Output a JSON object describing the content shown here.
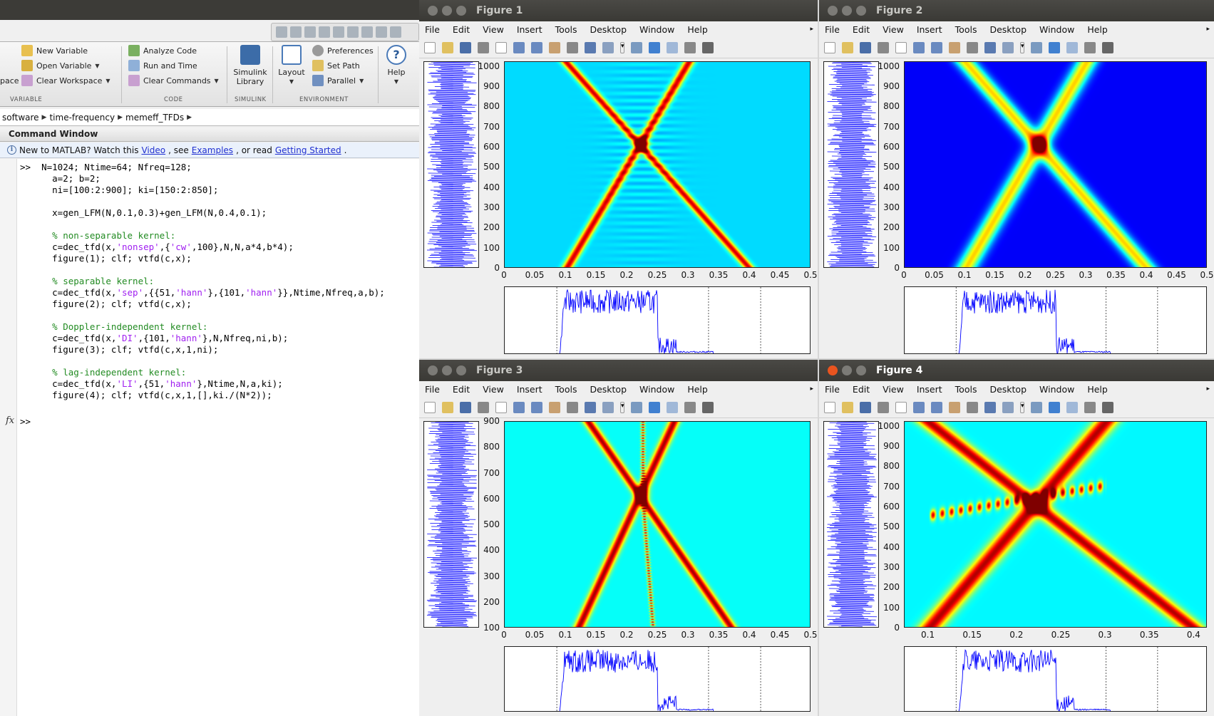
{
  "matlab": {
    "ribbon": {
      "variable": {
        "new_variable": "New Variable",
        "open_variable": "Open Variable",
        "clear_workspace": "Clear Workspace",
        "group": "VARIABLE",
        "partial": "pace"
      },
      "code": {
        "analyze_code": "Analyze Code",
        "run_and_time": "Run and Time",
        "clear_commands": "Clear Commands",
        "group": "CODE"
      },
      "simulink": {
        "label_1": "Simulink",
        "label_2": "Library",
        "group": "SIMULINK"
      },
      "environment": {
        "layout": "Layout",
        "preferences": "Preferences",
        "set_path": "Set Path",
        "parallel": "Parallel",
        "group": "ENVIRONMENT"
      },
      "help": "Help"
    },
    "path": [
      "software",
      "time-frequency",
      "memeff_TFDs"
    ],
    "command_window_title": "Command Window",
    "news": {
      "text_1": "New to MATLAB? Watch this ",
      "video": "Video",
      "text_2": ", see ",
      "examples": "Examples",
      "text_3": ", or read ",
      "getting_started": "Getting Started",
      "text_4": "."
    },
    "prompt": ">>",
    "fx": "fx",
    "code": [
      [
        {
          "t": ">>  N=1024; Ntime=64; Nfreq=128;",
          "c": ""
        }
      ],
      [
        {
          "t": "      a=2; b=2;",
          "c": ""
        }
      ],
      [
        {
          "t": "      ni=[100:2:900]; ki=[150:2:850];",
          "c": ""
        }
      ],
      [
        {
          "t": "",
          "c": ""
        }
      ],
      [
        {
          "t": "      x=gen_LFM(N,0.1,0.3)+gen_LFM(N,0.4,0.1);",
          "c": ""
        }
      ],
      [
        {
          "t": "",
          "c": ""
        }
      ],
      [
        {
          "t": "      % non-separable kernel:",
          "c": "cm"
        }
      ],
      [
        {
          "t": "      c=dec_tfd(x,",
          "c": ""
        },
        {
          "t": "'nonsep'",
          "c": "st"
        },
        {
          "t": ",{",
          "c": ""
        },
        {
          "t": "'cw'",
          "c": "st"
        },
        {
          "t": ",100},N,N,a*4,b*4);",
          "c": ""
        }
      ],
      [
        {
          "t": "      figure(1); clf; vtfd(c,x);",
          "c": ""
        }
      ],
      [
        {
          "t": "",
          "c": ""
        }
      ],
      [
        {
          "t": "      % separable kernel:",
          "c": "cm"
        }
      ],
      [
        {
          "t": "      c=dec_tfd(x,",
          "c": ""
        },
        {
          "t": "'sep'",
          "c": "st"
        },
        {
          "t": ",{{51,",
          "c": ""
        },
        {
          "t": "'hann'",
          "c": "st"
        },
        {
          "t": "},{101,",
          "c": ""
        },
        {
          "t": "'hann'",
          "c": "st"
        },
        {
          "t": "}},Ntime,Nfreq,a,b);",
          "c": ""
        }
      ],
      [
        {
          "t": "      figure(2); clf; vtfd(c,x);",
          "c": ""
        }
      ],
      [
        {
          "t": "",
          "c": ""
        }
      ],
      [
        {
          "t": "      % Doppler-independent kernel:",
          "c": "cm"
        }
      ],
      [
        {
          "t": "      c=dec_tfd(x,",
          "c": ""
        },
        {
          "t": "'DI'",
          "c": "st"
        },
        {
          "t": ",{101,",
          "c": ""
        },
        {
          "t": "'hann'",
          "c": "st"
        },
        {
          "t": "},N,Nfreq,ni,b);",
          "c": ""
        }
      ],
      [
        {
          "t": "      figure(3); clf; vtfd(c,x,1,ni);",
          "c": ""
        }
      ],
      [
        {
          "t": "",
          "c": ""
        }
      ],
      [
        {
          "t": "      % lag-independent kernel:",
          "c": "cm"
        }
      ],
      [
        {
          "t": "      c=dec_tfd(x,",
          "c": ""
        },
        {
          "t": "'LI'",
          "c": "st"
        },
        {
          "t": ",{51,",
          "c": ""
        },
        {
          "t": "'hann'",
          "c": "st"
        },
        {
          "t": "},Ntime,N,a,ki);",
          "c": ""
        }
      ],
      [
        {
          "t": "      figure(4); clf; vtfd(c,x,1,[],ki./(N*2));",
          "c": ""
        }
      ]
    ]
  },
  "menu": [
    "File",
    "Edit",
    "View",
    "Insert",
    "Tools",
    "Desktop",
    "Window",
    "Help"
  ],
  "figures": [
    {
      "title": "Figure 1",
      "active": false,
      "yticks": [
        "1000",
        "900",
        "800",
        "700",
        "600",
        "500",
        "400",
        "300",
        "200",
        "100",
        "0"
      ],
      "ymin": 0,
      "ymax": 1024,
      "xticks": [
        "0",
        "0.05",
        "0.1",
        "0.15",
        "0.2",
        "0.25",
        "0.3",
        "0.35",
        "0.4",
        "0.45",
        "0.5"
      ],
      "xmin": 0,
      "xmax": 0.5,
      "style": "nonsep"
    },
    {
      "title": "Figure 2",
      "active": false,
      "yticks": [
        "1000",
        "900",
        "800",
        "700",
        "600",
        "500",
        "400",
        "300",
        "200",
        "100",
        "0"
      ],
      "ymin": 0,
      "ymax": 1024,
      "xticks": [
        "0",
        "0.05",
        "0.1",
        "0.15",
        "0.2",
        "0.25",
        "0.3",
        "0.35",
        "0.4",
        "0.45",
        "0.5"
      ],
      "xmin": 0,
      "xmax": 0.5,
      "style": "sep"
    },
    {
      "title": "Figure 3",
      "active": false,
      "yticks": [
        "900",
        "800",
        "700",
        "600",
        "500",
        "400",
        "300",
        "200",
        "100"
      ],
      "ymin": 100,
      "ymax": 900,
      "xticks": [
        "0",
        "0.05",
        "0.1",
        "0.15",
        "0.2",
        "0.25",
        "0.3",
        "0.35",
        "0.4",
        "0.45",
        "0.5"
      ],
      "xmin": 0,
      "xmax": 0.5,
      "style": "di"
    },
    {
      "title": "Figure 4",
      "active": true,
      "yticks": [
        "1000",
        "900",
        "800",
        "700",
        "600",
        "500",
        "400",
        "300",
        "200",
        "100",
        "0"
      ],
      "ymin": 0,
      "ymax": 1024,
      "xticks": [
        "0.1",
        "0.15",
        "0.2",
        "0.25",
        "0.3",
        "0.35",
        "0.4"
      ],
      "xmin": 0.073,
      "xmax": 0.415,
      "style": "li"
    }
  ],
  "colors": {
    "signal": "#0000ff",
    "bg_low": "#00a0ff",
    "bg_dark": "#0000a0",
    "peak": "#ff2000",
    "close": "#e9541f",
    "comment": "#228b22",
    "string": "#a020f0"
  }
}
